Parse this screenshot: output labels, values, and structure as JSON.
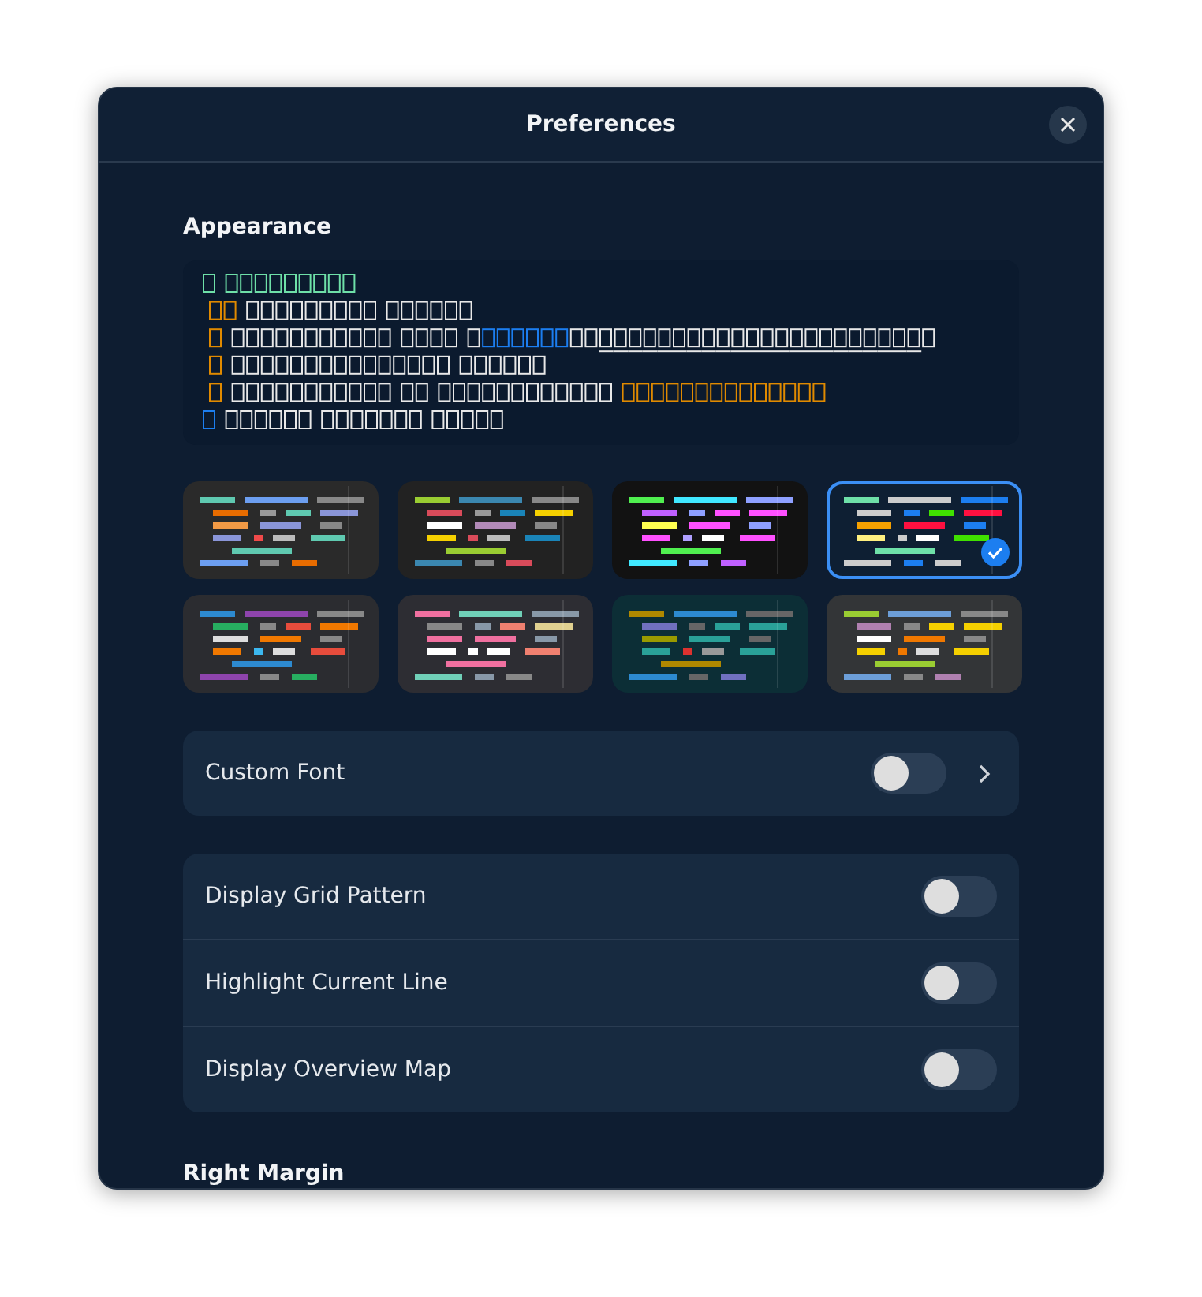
{
  "window": {
    "title": "Preferences"
  },
  "appearance": {
    "heading": "Appearance",
    "schemes": [
      {
        "color": "#2a2a2a",
        "selected": false
      },
      {
        "color": "#222222",
        "selected": false
      },
      {
        "color": "#121212",
        "selected": false
      },
      {
        "color": "#0e1f33",
        "selected": true
      },
      {
        "color": "#2b2c30",
        "selected": false
      },
      {
        "color": "#2d2d33",
        "selected": false
      },
      {
        "color": "#0c2e36",
        "selected": false
      },
      {
        "color": "#333537",
        "selected": false
      }
    ]
  },
  "font_row": {
    "label": "Custom Font",
    "on": false
  },
  "toggles": [
    {
      "label": "Display Grid Pattern",
      "on": false
    },
    {
      "label": "Highlight Current Line",
      "on": false
    },
    {
      "label": "Display Overview Map",
      "on": false
    }
  ],
  "next_heading": "Right Margin"
}
